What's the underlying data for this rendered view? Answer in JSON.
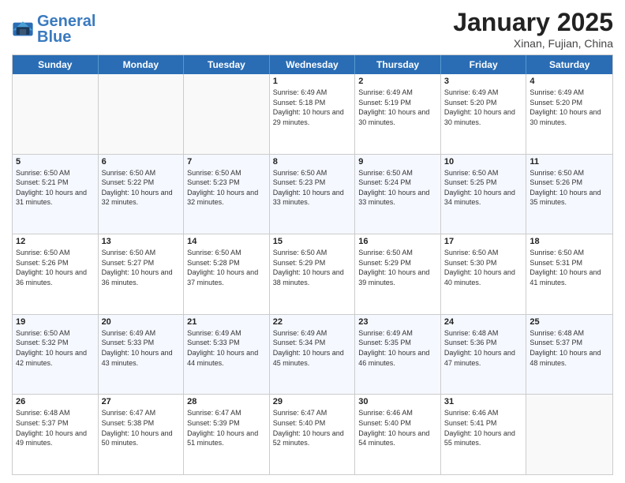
{
  "header": {
    "logo_general": "General",
    "logo_blue": "Blue",
    "title": "January 2025",
    "subtitle": "Xinan, Fujian, China"
  },
  "weekdays": [
    "Sunday",
    "Monday",
    "Tuesday",
    "Wednesday",
    "Thursday",
    "Friday",
    "Saturday"
  ],
  "weeks": [
    [
      {
        "day": "",
        "empty": true
      },
      {
        "day": "",
        "empty": true
      },
      {
        "day": "",
        "empty": true
      },
      {
        "day": "1",
        "sunrise": "6:49 AM",
        "sunset": "5:18 PM",
        "daylight": "10 hours and 29 minutes."
      },
      {
        "day": "2",
        "sunrise": "6:49 AM",
        "sunset": "5:19 PM",
        "daylight": "10 hours and 30 minutes."
      },
      {
        "day": "3",
        "sunrise": "6:49 AM",
        "sunset": "5:20 PM",
        "daylight": "10 hours and 30 minutes."
      },
      {
        "day": "4",
        "sunrise": "6:49 AM",
        "sunset": "5:20 PM",
        "daylight": "10 hours and 30 minutes."
      }
    ],
    [
      {
        "day": "5",
        "sunrise": "6:50 AM",
        "sunset": "5:21 PM",
        "daylight": "10 hours and 31 minutes."
      },
      {
        "day": "6",
        "sunrise": "6:50 AM",
        "sunset": "5:22 PM",
        "daylight": "10 hours and 32 minutes."
      },
      {
        "day": "7",
        "sunrise": "6:50 AM",
        "sunset": "5:23 PM",
        "daylight": "10 hours and 32 minutes."
      },
      {
        "day": "8",
        "sunrise": "6:50 AM",
        "sunset": "5:23 PM",
        "daylight": "10 hours and 33 minutes."
      },
      {
        "day": "9",
        "sunrise": "6:50 AM",
        "sunset": "5:24 PM",
        "daylight": "10 hours and 33 minutes."
      },
      {
        "day": "10",
        "sunrise": "6:50 AM",
        "sunset": "5:25 PM",
        "daylight": "10 hours and 34 minutes."
      },
      {
        "day": "11",
        "sunrise": "6:50 AM",
        "sunset": "5:26 PM",
        "daylight": "10 hours and 35 minutes."
      }
    ],
    [
      {
        "day": "12",
        "sunrise": "6:50 AM",
        "sunset": "5:26 PM",
        "daylight": "10 hours and 36 minutes."
      },
      {
        "day": "13",
        "sunrise": "6:50 AM",
        "sunset": "5:27 PM",
        "daylight": "10 hours and 36 minutes."
      },
      {
        "day": "14",
        "sunrise": "6:50 AM",
        "sunset": "5:28 PM",
        "daylight": "10 hours and 37 minutes."
      },
      {
        "day": "15",
        "sunrise": "6:50 AM",
        "sunset": "5:29 PM",
        "daylight": "10 hours and 38 minutes."
      },
      {
        "day": "16",
        "sunrise": "6:50 AM",
        "sunset": "5:29 PM",
        "daylight": "10 hours and 39 minutes."
      },
      {
        "day": "17",
        "sunrise": "6:50 AM",
        "sunset": "5:30 PM",
        "daylight": "10 hours and 40 minutes."
      },
      {
        "day": "18",
        "sunrise": "6:50 AM",
        "sunset": "5:31 PM",
        "daylight": "10 hours and 41 minutes."
      }
    ],
    [
      {
        "day": "19",
        "sunrise": "6:50 AM",
        "sunset": "5:32 PM",
        "daylight": "10 hours and 42 minutes."
      },
      {
        "day": "20",
        "sunrise": "6:49 AM",
        "sunset": "5:33 PM",
        "daylight": "10 hours and 43 minutes."
      },
      {
        "day": "21",
        "sunrise": "6:49 AM",
        "sunset": "5:33 PM",
        "daylight": "10 hours and 44 minutes."
      },
      {
        "day": "22",
        "sunrise": "6:49 AM",
        "sunset": "5:34 PM",
        "daylight": "10 hours and 45 minutes."
      },
      {
        "day": "23",
        "sunrise": "6:49 AM",
        "sunset": "5:35 PM",
        "daylight": "10 hours and 46 minutes."
      },
      {
        "day": "24",
        "sunrise": "6:48 AM",
        "sunset": "5:36 PM",
        "daylight": "10 hours and 47 minutes."
      },
      {
        "day": "25",
        "sunrise": "6:48 AM",
        "sunset": "5:37 PM",
        "daylight": "10 hours and 48 minutes."
      }
    ],
    [
      {
        "day": "26",
        "sunrise": "6:48 AM",
        "sunset": "5:37 PM",
        "daylight": "10 hours and 49 minutes."
      },
      {
        "day": "27",
        "sunrise": "6:47 AM",
        "sunset": "5:38 PM",
        "daylight": "10 hours and 50 minutes."
      },
      {
        "day": "28",
        "sunrise": "6:47 AM",
        "sunset": "5:39 PM",
        "daylight": "10 hours and 51 minutes."
      },
      {
        "day": "29",
        "sunrise": "6:47 AM",
        "sunset": "5:40 PM",
        "daylight": "10 hours and 52 minutes."
      },
      {
        "day": "30",
        "sunrise": "6:46 AM",
        "sunset": "5:40 PM",
        "daylight": "10 hours and 54 minutes."
      },
      {
        "day": "31",
        "sunrise": "6:46 AM",
        "sunset": "5:41 PM",
        "daylight": "10 hours and 55 minutes."
      },
      {
        "day": "",
        "empty": true
      }
    ]
  ]
}
